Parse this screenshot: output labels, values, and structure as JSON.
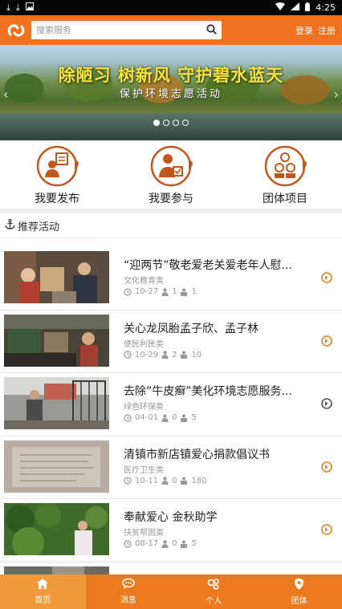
{
  "status_bar": {
    "time": "4:25",
    "icons": [
      "download-icon",
      "download-icon",
      "photo-icon",
      "wifi-icon",
      "signal-icon",
      "battery-icon"
    ]
  },
  "header": {
    "search_placeholder": "搜索服务",
    "login": "登录",
    "register": "注册",
    "accent_color": "#f0721f"
  },
  "banner": {
    "title": "除陋习 树新风 守护碧水蓝天",
    "subtitle": "保护环境志愿活动",
    "slide_count": 4,
    "active_slide": 1
  },
  "quick_entries": [
    {
      "label": "我要发布",
      "icon": "publish-icon"
    },
    {
      "label": "我要参与",
      "icon": "participate-icon"
    },
    {
      "label": "团体项目",
      "icon": "group-project-icon"
    }
  ],
  "section": {
    "title": "推荐活动",
    "icon": "anchor-icon"
  },
  "activities": [
    {
      "title": "“迎两节”敬老爱老关爱老年人慰...",
      "category": "文化教育类",
      "date": "10-27",
      "participants": "1",
      "groups": "1"
    },
    {
      "title": "关心龙凤胎孟子欣、孟子林",
      "category": "便民利民类",
      "date": "10-29",
      "participants": "2",
      "groups": "10"
    },
    {
      "title": "去除”牛皮癣”美化环境志愿服务...",
      "category": "绿色环保类",
      "date": "04-01",
      "participants": "0",
      "groups": "5"
    },
    {
      "title": "清镇市新店镇爱心捐款倡议书",
      "category": "医疗卫生类",
      "date": "10-11",
      "participants": "0",
      "groups": "180"
    },
    {
      "title": "奉献爱心 金秋助学",
      "category": "扶贫帮困类",
      "date": "08-17",
      "participants": "0",
      "groups": "5"
    }
  ],
  "tabbar": [
    {
      "label": "首页",
      "icon": "home-icon",
      "active": true
    },
    {
      "label": "消息",
      "icon": "message-icon",
      "active": false
    },
    {
      "label": "个人",
      "icon": "user-icon",
      "active": false
    },
    {
      "label": "团体",
      "icon": "location-icon",
      "active": false
    }
  ]
}
